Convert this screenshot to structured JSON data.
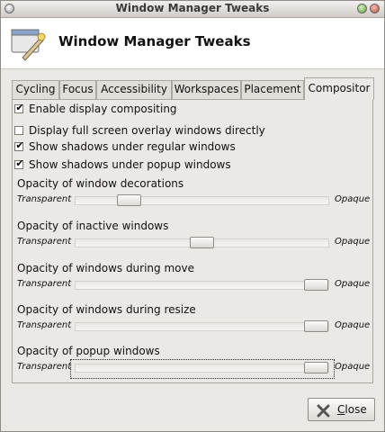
{
  "window": {
    "title": "Window Manager Tweaks"
  },
  "header": {
    "title": "Window Manager Tweaks",
    "icon": "settings-window-icon"
  },
  "tabs": [
    {
      "label": "Cycling",
      "active": false
    },
    {
      "label": "Focus",
      "active": false
    },
    {
      "label": "Accessibility",
      "active": false
    },
    {
      "label": "Workspaces",
      "active": false
    },
    {
      "label": "Placement",
      "active": false
    },
    {
      "label": "Compositor",
      "active": true
    }
  ],
  "compositor": {
    "checks": [
      {
        "label": "Enable display compositing",
        "checked": true
      },
      {
        "label": "Display full screen overlay windows directly",
        "checked": false
      },
      {
        "label": "Show shadows under regular windows",
        "checked": true
      },
      {
        "label": "Show shadows under popup windows",
        "checked": true
      }
    ],
    "sliders": [
      {
        "label": "Opacity of window decorations",
        "min_label": "Transparent",
        "max_label": "Opaque",
        "value_fraction": 0.18
      },
      {
        "label": "Opacity of inactive windows",
        "min_label": "Transparent",
        "max_label": "Opaque",
        "value_fraction": 0.5
      },
      {
        "label": "Opacity of windows during move",
        "min_label": "Transparent",
        "max_label": "Opaque",
        "value_fraction": 1.0
      },
      {
        "label": "Opacity of windows during resize",
        "min_label": "Transparent",
        "max_label": "Opaque",
        "value_fraction": 1.0
      },
      {
        "label": "Opacity of popup windows",
        "min_label": "Transparent",
        "max_label": "Opaque",
        "value_fraction": 1.0
      }
    ]
  },
  "footer": {
    "close_label": "Close",
    "close_icon": "close-x-icon"
  }
}
